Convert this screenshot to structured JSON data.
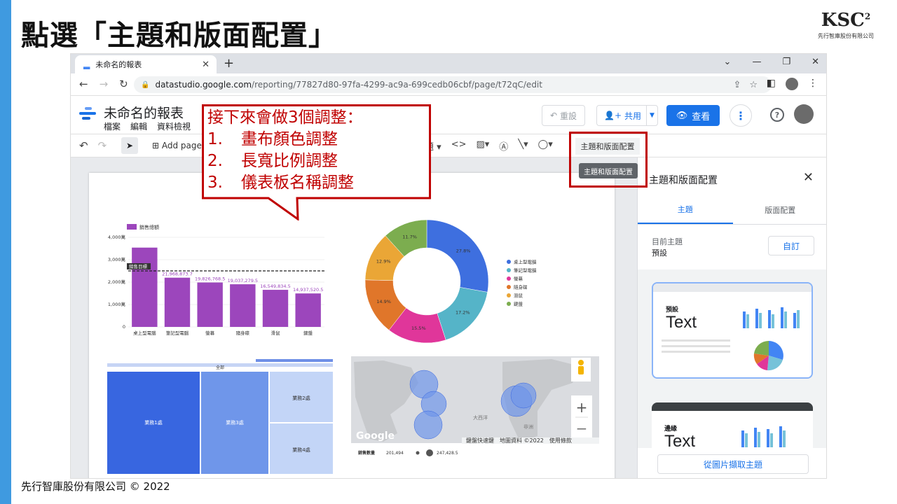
{
  "slide": {
    "title": "點選「主題和版面配置」",
    "footer": "先行智庫股份有限公司 © 2022",
    "brand_logo": "KSC",
    "brand_logo_sup": "2",
    "brand_sub": "先行智庫股份有限公司"
  },
  "browser": {
    "tab_title": "未命名的報表",
    "url_host": "datastudio.google.com",
    "url_path": "/reporting/77827d80-97fa-4299-ac9a-699cedb06cbf/page/t72qC/edit"
  },
  "app": {
    "report_title": "未命名的報表",
    "menus": [
      "檔案",
      "編輯",
      "資料檢視"
    ],
    "reset_label": "重設",
    "share_label": "共用",
    "view_label": "查看",
    "add_page_label": "Add page",
    "toolbar_partial_label": "題",
    "theme_button_label": "主題和版面配置",
    "tooltip": "主題和版面配置"
  },
  "callout": {
    "heading": "接下來會做3個調整：",
    "items": [
      {
        "num": "1.",
        "text": "畫布顏色調整"
      },
      {
        "num": "2.",
        "text": "長寬比例調整"
      },
      {
        "num": "3.",
        "text": "儀表板名稱調整"
      }
    ]
  },
  "panel": {
    "title": "主題和版面配置",
    "tabs": [
      "主題",
      "版面配置"
    ],
    "current_theme_label": "目前主題",
    "current_theme_value": "預設",
    "custom_button": "自訂",
    "themes": [
      {
        "name": "預設",
        "sample": "Text",
        "caption": "預設"
      },
      {
        "name": "邊緣",
        "sample": "Text"
      }
    ],
    "extract_button": "從圖片擷取主題"
  },
  "bar_chart": {
    "type": "bar",
    "legend": "銷售總額",
    "categories": [
      "桌上型電腦",
      "筆記型電腦",
      "螢幕",
      "隨身碟",
      "滑鼠",
      "鍵盤"
    ],
    "values": [
      35400000,
      21968873.7,
      19826768.5,
      19037279.5,
      16549834.5,
      14937520.5
    ],
    "value_labels": [
      "",
      "21,968,873.7",
      "19,826,768.5",
      "19,037,279.5",
      "16,549,834.5",
      "14,937,520.5"
    ],
    "yticks": [
      "0",
      "1,000萬",
      "2,000萬",
      "3,000萬",
      "4,000萬"
    ],
    "ylim": [
      0,
      40000000
    ],
    "target_value": 25000000,
    "target_label": "銷售目標",
    "color": "#9c46bc"
  },
  "pie_chart": {
    "type": "pie",
    "labels": [
      "桌上型電腦",
      "筆記型電腦",
      "螢幕",
      "隨身碟",
      "滑鼠",
      "鍵盤"
    ],
    "values": [
      27.8,
      17.2,
      15.5,
      14.9,
      12.9,
      11.7
    ],
    "value_labels": [
      "27.8%",
      "17.2%",
      "15.5%",
      "14.9%",
      "12.9%",
      "11.7%"
    ],
    "colors": [
      "#3e6fdf",
      "#55b4c8",
      "#e0369a",
      "#e0762a",
      "#eaa636",
      "#7cad4f"
    ]
  },
  "treemap": {
    "header": "全部",
    "cells": [
      "業務1處",
      "業務3處",
      "業務2處",
      "業務4處"
    ]
  },
  "map": {
    "ocean_label": "大西洋",
    "africa_label": "非洲",
    "google_label": "Google",
    "attribution": "鍵盤快速鍵　地圖資料 ©2022　使用條款",
    "legend_title": "銷售數量",
    "legend_min": "201,494",
    "legend_max": "247,428.5",
    "zoom_in": "+",
    "zoom_out": "−"
  }
}
